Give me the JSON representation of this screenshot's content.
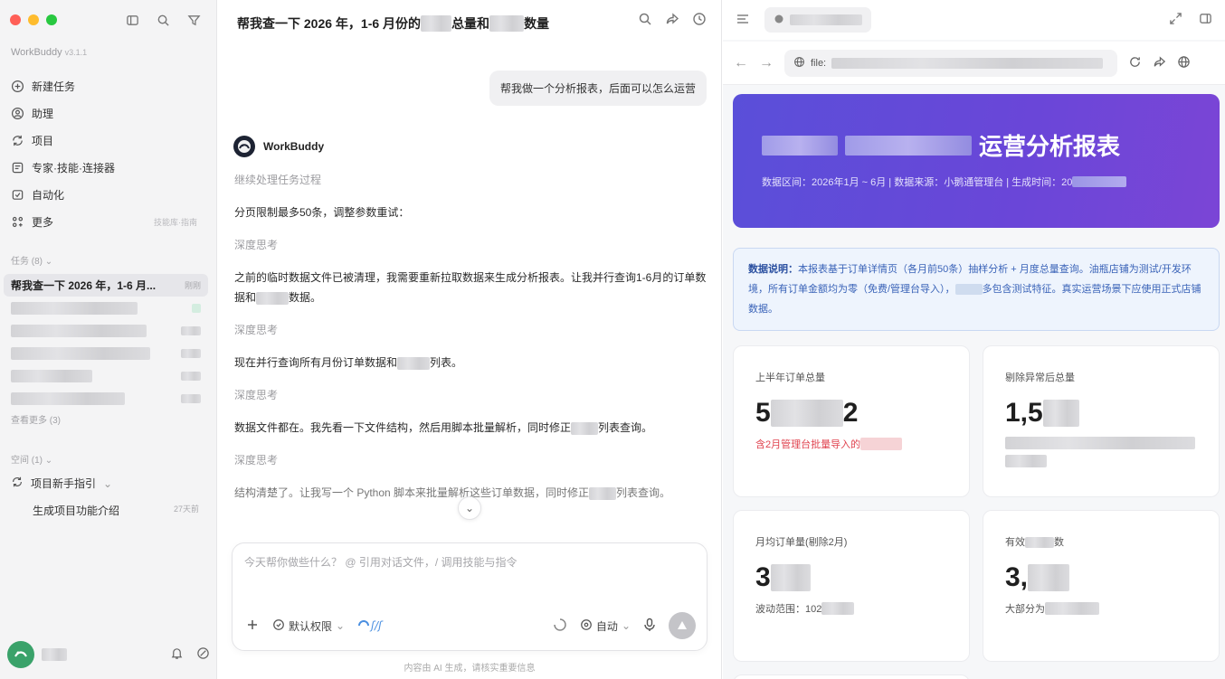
{
  "sidebar": {
    "brand": "WorkBuddy",
    "version": "v3.1.1",
    "nav": [
      {
        "label": "新建任务",
        "icon": "plus-circle-icon"
      },
      {
        "label": "助理",
        "icon": "assistant-icon"
      },
      {
        "label": "项目",
        "icon": "project-icon"
      },
      {
        "label": "专家·技能·连接器",
        "icon": "expert-icon"
      },
      {
        "label": "自动化",
        "icon": "automation-icon"
      },
      {
        "label": "更多",
        "icon": "more-icon",
        "hint": "技能库·指南"
      }
    ],
    "tasks_header": "任务 (8)",
    "active_task": "帮我查一下 2026 年，1-6 月...",
    "active_task_time": "刚刚",
    "see_more": "查看更多 (3)",
    "spaces_header": "空间 (1)",
    "space_item": "项目新手指引",
    "space_subitem": "生成项目功能介绍",
    "space_subitem_time": "27天前"
  },
  "chat": {
    "title_prefix": "帮我查一下 2026 年，1-6 月份的",
    "title_mid": "总量和",
    "title_suffix": "数量",
    "user_message": "帮我做一个分析报表，后面可以怎么运营",
    "bot_name": "WorkBuddy",
    "messages": [
      {
        "text": "继续处理任务过程",
        "kind": "think"
      },
      {
        "text": "分页限制最多50条，调整参数重试：",
        "kind": "normal"
      },
      {
        "text": "深度思考",
        "kind": "think"
      },
      {
        "text": "之前的临时数据文件已被清理，我需要重新拉取数据来生成分析报表。让我并行查询1-6月的订单数据和",
        "tail": "数据。",
        "kind": "normal"
      },
      {
        "text": "深度思考",
        "kind": "think"
      },
      {
        "text": "现在并行查询所有月份订单数据和",
        "tail": "列表。",
        "kind": "normal"
      },
      {
        "text": "深度思考",
        "kind": "think"
      },
      {
        "text": "数据文件都在。我先看一下文件结构，然后用脚本批量解析，同时修正",
        "tail": "列表查询。",
        "kind": "normal"
      },
      {
        "text": "深度思考",
        "kind": "think"
      },
      {
        "text": "结构清楚了。让我写一个 Python 脚本来批量解析这些订单数据，同时修正",
        "tail": "列表查询。",
        "kind": "normal"
      }
    ],
    "composer_placeholder": "今天帮你做些什么？ @ 引用对话文件，/ 调用技能与指令",
    "permission_label": "默认权限",
    "mode_label": "自动",
    "disclaimer": "内容由 AI 生成，请核实重要信息"
  },
  "preview": {
    "url_prefix": "file:",
    "hero_title": "运营分析报表",
    "hero_meta": "数据区间：2026年1月 ~ 6月 | 数据来源：小鹅通管理台 | 生成时间：20",
    "note_label": "数据说明：",
    "note_text": "本报表基于订单详情页（各月前50条）抽样分析 + 月度总量查询。油瓶店铺为测试/开发环境，所有订单金额均为零（免费/管理台导入），",
    "note_tail": "多包含测试特征。真实运营场景下应使用正式店铺数据。",
    "kpis": [
      {
        "label": "上半年订单总量",
        "value_head": "5",
        "value_tail": "2",
        "sub": "含2月管理台批量导入的",
        "sub_color": "red"
      },
      {
        "label": "剔除异常后总量",
        "value_head": "1,5",
        "value_tail": "",
        "sub": "",
        "sub_color": "gray"
      },
      {
        "label": "月均订单量(剔除2月)",
        "value_head": "3",
        "value_tail": "",
        "sub": "波动范围：102",
        "sub_color": "gray"
      },
      {
        "label_head": "有效",
        "label_tail": "数",
        "value_head": "3,",
        "value_tail": "",
        "sub": "大部分为",
        "sub_color": "gray"
      }
    ]
  },
  "colors": {
    "accent": "#5b4fd9",
    "alert_red": "#e0434f",
    "note_blue": "#3a63b8"
  }
}
